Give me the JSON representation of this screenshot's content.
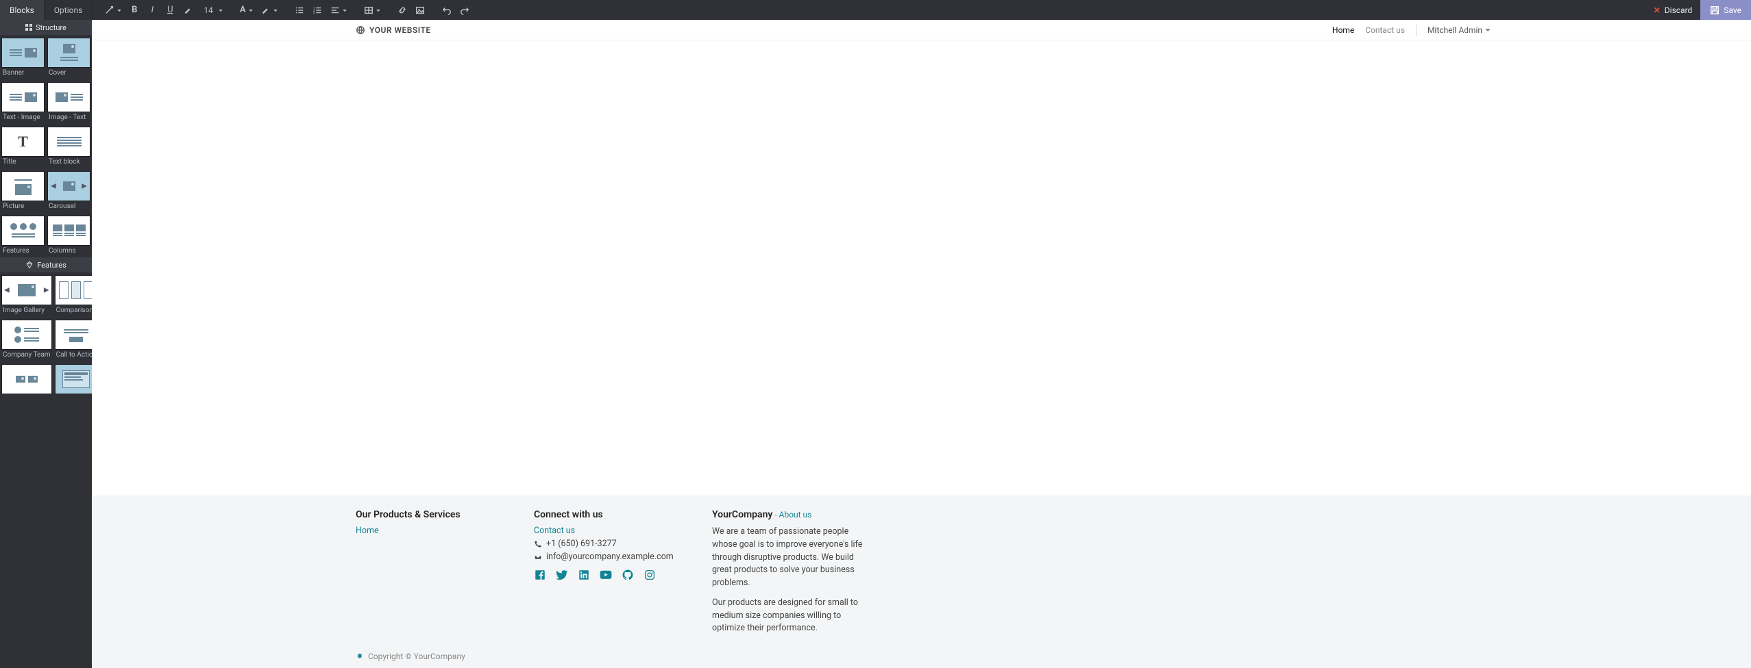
{
  "tabs": {
    "blocks": "Blocks",
    "options": "Options"
  },
  "toolbar": {
    "font_size": "14",
    "font_letter": "A",
    "discard": "Discard",
    "save": "Save"
  },
  "sidebar": {
    "heading_structure": "Structure",
    "heading_features": "Features",
    "items": [
      {
        "label": "Banner"
      },
      {
        "label": "Cover"
      },
      {
        "label": "Text - Image"
      },
      {
        "label": "Image - Text"
      },
      {
        "label": "Title"
      },
      {
        "label": "Text block"
      },
      {
        "label": "Picture"
      },
      {
        "label": "Carousel"
      },
      {
        "label": "Features"
      },
      {
        "label": "Columns"
      },
      {
        "label": "Image Gallery"
      },
      {
        "label": "Comparisons"
      },
      {
        "label": "Company Team"
      },
      {
        "label": "Call to Action"
      }
    ]
  },
  "site": {
    "brand": "YOUR WEBSITE",
    "nav": {
      "home": "Home",
      "contact": "Contact us",
      "user": "Mitchell Admin"
    }
  },
  "footer": {
    "col1_title": "Our Products & Services",
    "col1_link": "Home",
    "col2_title": "Connect with us",
    "col2_contact_link": "Contact us",
    "phone": "+1 (650) 691-3277",
    "email": "info@yourcompany.example.com",
    "col3_title": "YourCompany",
    "col3_about_sep": " - ",
    "col3_about": "About us",
    "about_p1": "We are a team of passionate people whose goal is to improve everyone's life through disruptive products. We build great products to solve your business problems.",
    "about_p2": "Our products are designed for small to medium size companies willing to optimize their performance.",
    "copyright": "Copyright © YourCompany"
  }
}
